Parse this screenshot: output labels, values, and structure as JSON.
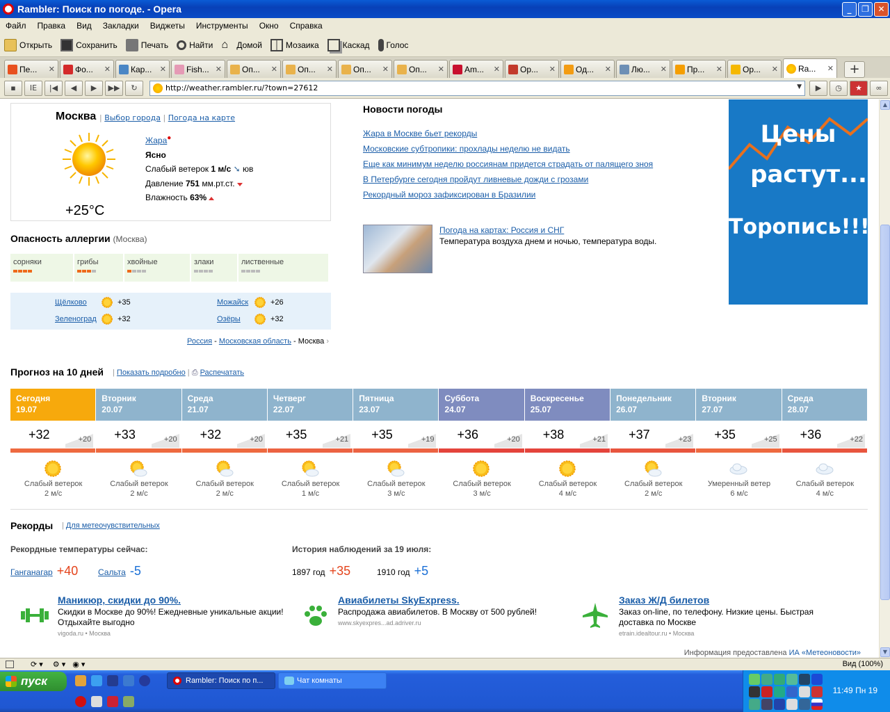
{
  "window": {
    "title": "Rambler: Поиск по погоде. - Opera"
  },
  "menu": [
    "Файл",
    "Правка",
    "Вид",
    "Закладки",
    "Виджеты",
    "Инструменты",
    "Окно",
    "Справка"
  ],
  "toolbar": {
    "open": "Открыть",
    "save": "Сохранить",
    "print": "Печать",
    "find": "Найти",
    "home": "Домой",
    "mosaic": "Мозаика",
    "cascade": "Каскад",
    "voice": "Голос"
  },
  "tabs": [
    {
      "label": "Пе...",
      "color": "#e8501e"
    },
    {
      "label": "Фо...",
      "color": "#d42a2a"
    },
    {
      "label": "Кар...",
      "color": "#4a86c5"
    },
    {
      "label": "Fish...",
      "color": "#e59ab5"
    },
    {
      "label": "Оп...",
      "color": "#e9b24b"
    },
    {
      "label": "Оп...",
      "color": "#e9b24b"
    },
    {
      "label": "Оп...",
      "color": "#e9b24b"
    },
    {
      "label": "Оп...",
      "color": "#e9b24b"
    },
    {
      "label": "Am...",
      "color": "#c8102e"
    },
    {
      "label": "Ор...",
      "color": "#c23a2b"
    },
    {
      "label": "Од...",
      "color": "#f39c12"
    },
    {
      "label": "Лю...",
      "color": "#6d8fb5"
    },
    {
      "label": "Пр...",
      "color": "#f59e00"
    },
    {
      "label": "Ор...",
      "color": "#f5b800"
    },
    {
      "label": "Ra...",
      "color": "#f5b800"
    }
  ],
  "address": {
    "url": "http://weather.rambler.ru/?town=27612"
  },
  "current": {
    "city": "Москва",
    "link_city": "Выбор города",
    "link_map": "Погода на карте",
    "warning": "Жара",
    "condition": "Ясно",
    "wind_prefix": "Слабый ветерок",
    "wind_value": "1 м/с",
    "wind_dir": "юв",
    "pressure_prefix": "Давление",
    "pressure_value": "751",
    "pressure_unit": "мм.рт.ст.",
    "humidity_prefix": "Влажность",
    "humidity_value": "63%",
    "temp": "+25°C"
  },
  "allergy": {
    "title": "Опасность аллергии",
    "city": "(Москва)",
    "items": [
      {
        "name": "сорняки",
        "level": 4
      },
      {
        "name": "грибы",
        "level": 3
      },
      {
        "name": "хвойные",
        "level": 1
      },
      {
        "name": "злаки",
        "level": 0
      },
      {
        "name": "лиственные",
        "level": 0
      }
    ]
  },
  "nearby": [
    {
      "name": "Щёлково",
      "temp": "+35"
    },
    {
      "name": "Можайск",
      "temp": "+26"
    },
    {
      "name": "Зеленоград",
      "temp": "+32"
    },
    {
      "name": "Озёры",
      "temp": "+32"
    }
  ],
  "breadcrumb": {
    "a": "Россия",
    "b": "Московская область",
    "c": "Москва"
  },
  "news": {
    "title": "Новости погоды",
    "items": [
      "Жара в Москве бьет рекорды",
      "Московские субтропики: прохлады неделю не видать",
      "Еще как минимум неделю россиянам придется страдать от палящего зноя",
      "В Петербурге сегодня пройдут ливневые дожди с грозами",
      "Рекордный мороз зафиксирован в Бразилии"
    ],
    "map_link": "Погода на картах: Россия и СНГ",
    "map_desc": "Температура воздуха днем и ночью, температура воды."
  },
  "banner": {
    "line1": "Цены",
    "line2": "растут...",
    "line3": "Торопись!!!"
  },
  "forecast": {
    "title": "Прогноз на 10 дней",
    "link_detail": "Показать подробно",
    "link_print": "Распечатать",
    "days": [
      {
        "day": "Сегодня",
        "date": "19.07",
        "day_t": "+32",
        "night_t": "+20",
        "wind": "Слабый ветерок",
        "speed": "2 м/с",
        "color": "#f7a90c",
        "icon": "sun-icon"
      },
      {
        "day": "Вторник",
        "date": "20.07",
        "day_t": "+33",
        "night_t": "+20",
        "wind": "Слабый ветерок",
        "speed": "2 м/с",
        "color": "#8fb4cd",
        "icon": "sun-cloud-icon"
      },
      {
        "day": "Среда",
        "date": "21.07",
        "day_t": "+32",
        "night_t": "+20",
        "wind": "Слабый ветерок",
        "speed": "2 м/с",
        "color": "#8fb4cd",
        "icon": "sun-cloud-icon"
      },
      {
        "day": "Четверг",
        "date": "22.07",
        "day_t": "+35",
        "night_t": "+21",
        "wind": "Слабый ветерок",
        "speed": "1 м/с",
        "color": "#8fb4cd",
        "icon": "sun-cloud-icon"
      },
      {
        "day": "Пятница",
        "date": "23.07",
        "day_t": "+35",
        "night_t": "+19",
        "wind": "Слабый ветерок",
        "speed": "3 м/с",
        "color": "#8fb4cd",
        "icon": "sun-cloud-icon"
      },
      {
        "day": "Суббота",
        "date": "24.07",
        "day_t": "+36",
        "night_t": "+20",
        "wind": "Слабый ветерок",
        "speed": "3 м/с",
        "color": "#7f8cbf",
        "icon": "sun-icon"
      },
      {
        "day": "Воскресенье",
        "date": "25.07",
        "day_t": "+38",
        "night_t": "+21",
        "wind": "Слабый ветерок",
        "speed": "4 м/с",
        "color": "#7f8cbf",
        "icon": "sun-icon"
      },
      {
        "day": "Понедельник",
        "date": "26.07",
        "day_t": "+37",
        "night_t": "+23",
        "wind": "Слабый ветерок",
        "speed": "2 м/с",
        "color": "#8fb4cd",
        "icon": "sun-cloud-icon"
      },
      {
        "day": "Вторник",
        "date": "27.07",
        "day_t": "+35",
        "night_t": "+25",
        "wind": "Умеренный ветер",
        "speed": "6 м/с",
        "color": "#8fb4cd",
        "icon": "cloud-icon"
      },
      {
        "day": "Среда",
        "date": "28.07",
        "day_t": "+36",
        "night_t": "+22",
        "wind": "Слабый ветерок",
        "speed": "4 м/с",
        "color": "#8fb4cd",
        "icon": "cloud-icon"
      }
    ]
  },
  "records": {
    "title": "Рекорды",
    "link": "Для метеочувствительных",
    "now_title": "Рекордные температуры сейчас:",
    "hot_city": "Ганганагар",
    "hot_value": "+40",
    "cold_city": "Сальта",
    "cold_value": "-5",
    "hist_title": "История наблюдений за 19 июля:",
    "hist_hot_year": "1897 год",
    "hist_hot_value": "+35",
    "hist_cold_year": "1910 год",
    "hist_cold_value": "+5"
  },
  "ads": [
    {
      "title": "Маникюр, скидки до 90%.",
      "desc": "Скидки в Москве до 90%! Ежедневные уникальные акции! Отдыхайте выгодно",
      "src": "vigoda.ru • Москва"
    },
    {
      "title": "Авиабилеты SkyExpress.",
      "desc": "Распродажа авиабилетов. В Москву от 500 рублей!",
      "src": "www.skyexpres...ad.adriver.ru"
    },
    {
      "title": "Заказ Ж/Д билетов",
      "desc": "Заказ on-line, по телефону. Низкие цены. Быстрая доставка по Москве",
      "src": "etrain.idealtour.ru • Москва"
    }
  ],
  "source": {
    "prefix": "Информация предоставлена",
    "link": "ИА «Метеоновости»"
  },
  "status": {
    "zoom": "Вид (100%)"
  },
  "taskbar": {
    "start": "пуск",
    "item1": "Rambler: Поиск по п...",
    "item2": "Чат комнаты",
    "clock": "11:49 Пн 19"
  }
}
